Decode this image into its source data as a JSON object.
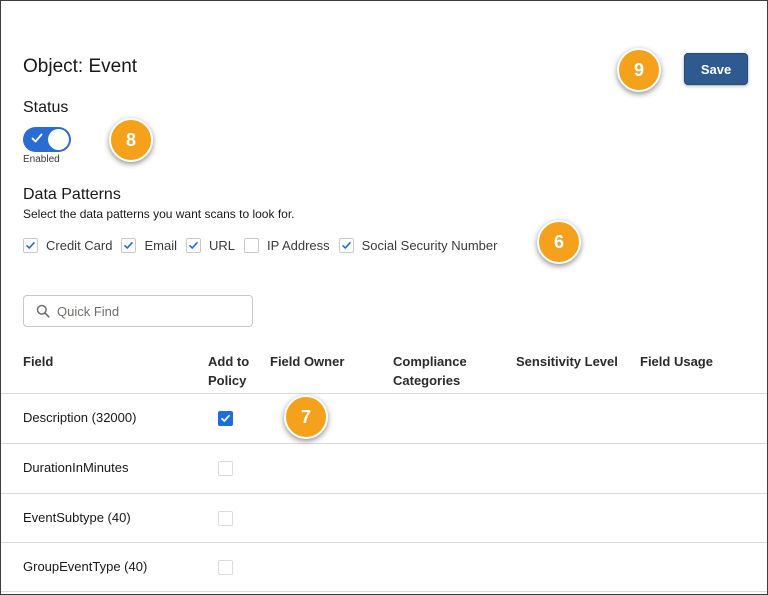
{
  "page": {
    "title": "Object: Event",
    "save_label": "Save"
  },
  "status": {
    "heading": "Status",
    "toggle_label": "Enabled",
    "enabled": true
  },
  "data_patterns": {
    "heading": "Data Patterns",
    "subtitle": "Select the data patterns you want scans to look for.",
    "items": [
      {
        "label": "Credit Card",
        "checked": true
      },
      {
        "label": "Email",
        "checked": true
      },
      {
        "label": "URL",
        "checked": true
      },
      {
        "label": "IP Address",
        "checked": false
      },
      {
        "label": "Social Security Number",
        "checked": true
      }
    ]
  },
  "search": {
    "placeholder": "Quick Find"
  },
  "table": {
    "headers": {
      "field": "Field",
      "add_to_policy_1": "Add to",
      "add_to_policy_2": "Policy",
      "field_owner": "Field Owner",
      "compliance_1": "Compliance",
      "compliance_2": "Categories",
      "sensitivity": "Sensitivity Level",
      "usage": "Field Usage"
    },
    "rows": [
      {
        "field": "Description (32000)",
        "add_to_policy": true
      },
      {
        "field": "DurationInMinutes",
        "add_to_policy": false
      },
      {
        "field": "EventSubtype (40)",
        "add_to_policy": false
      },
      {
        "field": "GroupEventType (40)",
        "add_to_policy": false
      }
    ]
  },
  "callouts": [
    "9",
    "8",
    "6",
    "7"
  ],
  "colors": {
    "save_button": "#2f5a8f",
    "toggle_on": "#2b6cd2",
    "checkbox_checked": "#1b6ee0",
    "callout": "#f5a11c"
  },
  "icons": {
    "toggle_tick": "check-icon",
    "checkbox_tick": "check-icon",
    "search": "search-icon"
  }
}
